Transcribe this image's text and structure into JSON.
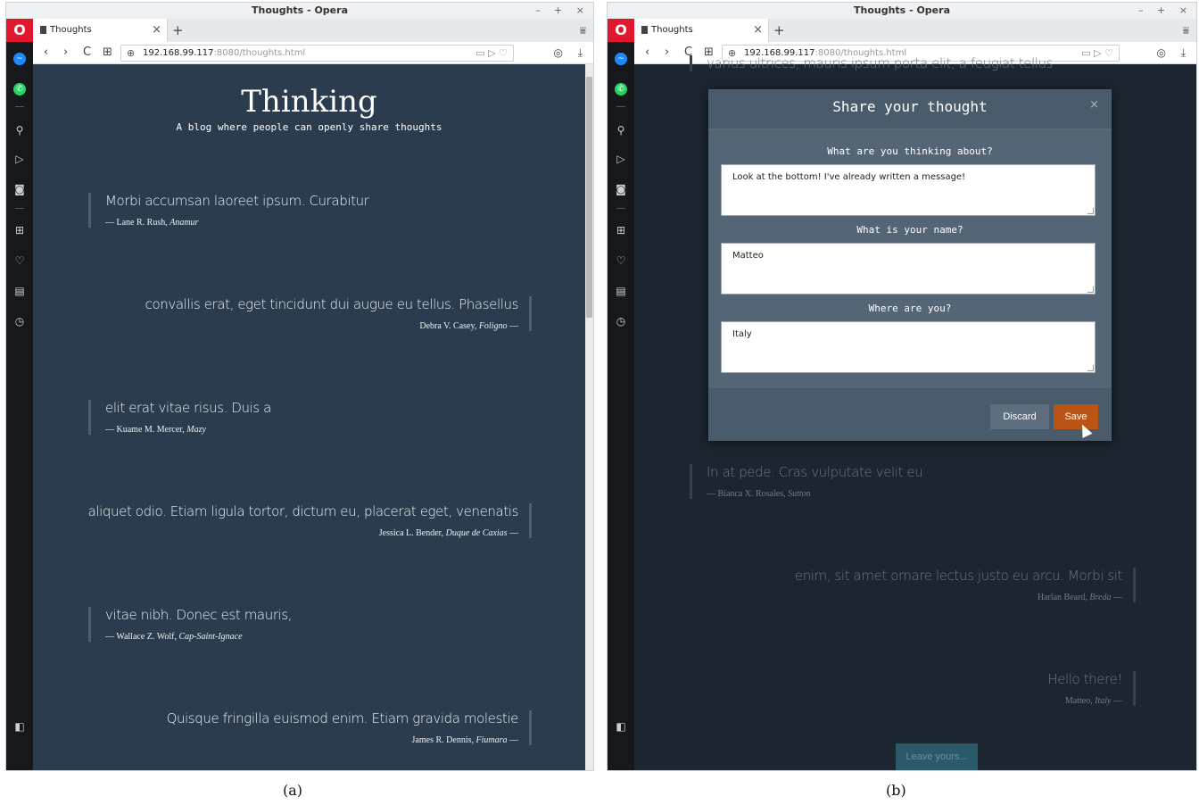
{
  "browser": {
    "window_title": "Thoughts - Opera",
    "logo": "O",
    "tab_title": "Thoughts",
    "tab_close": "×",
    "new_tab": "+",
    "tab_menu": "⩸",
    "url_host": "192.168.99.117",
    "url_path": ":8080/thoughts.html",
    "window_controls": "– + ×",
    "nav": {
      "back": "‹",
      "forward": "›",
      "reload": "C",
      "grid": "⊞",
      "globe": "⊕",
      "url_icons": "▭ ▷ ♡",
      "snap": "◎",
      "download": "⤓"
    },
    "sidebar_icons": [
      {
        "name": "messenger-icon",
        "glyph": "~",
        "color": "#1e88ff"
      },
      {
        "name": "whatsapp-icon",
        "glyph": "✆",
        "color": "#25d366"
      },
      {
        "name": "search-icon",
        "glyph": "⚲"
      },
      {
        "name": "send-icon",
        "glyph": "▷"
      },
      {
        "name": "camera-icon",
        "glyph": "◙"
      },
      {
        "name": "speed-dial-icon",
        "glyph": "⊞"
      },
      {
        "name": "heart-icon",
        "glyph": "♡"
      },
      {
        "name": "news-icon",
        "glyph": "▤"
      },
      {
        "name": "history-icon",
        "glyph": "◷"
      }
    ],
    "sidebar_toggle": "◧"
  },
  "blog": {
    "title": "Thinking",
    "subtitle": "A blog where people can openly share thoughts"
  },
  "panel_a": {
    "posts": [
      {
        "text": "Morbi accumsan laoreet ipsum. Curabitur",
        "author": "— Lane R. Rush, ",
        "place": "Anamur",
        "suffix": "",
        "align": "left"
      },
      {
        "text": "convallis erat, eget tincidunt dui augue eu tellus. Phasellus",
        "author": "Debra V. Casey, ",
        "place": "Foligno",
        "suffix": " —",
        "align": "right"
      },
      {
        "text": "elit erat vitae risus. Duis a",
        "author": "— Kuame M. Mercer, ",
        "place": "Mazy",
        "suffix": "",
        "align": "left"
      },
      {
        "text": "aliquet odio. Etiam ligula tortor, dictum eu, placerat eget, venenatis",
        "author": "Jessica L. Bender, ",
        "place": "Duque de Caxias",
        "suffix": " —",
        "align": "right"
      },
      {
        "text": "vitae nibh. Donec est mauris,",
        "author": "— Wallace Z. Wolf, ",
        "place": "Cap-Saint-Ignace",
        "suffix": "",
        "align": "left"
      },
      {
        "text": "Quisque fringilla euismod enim. Etiam gravida molestie",
        "author": "James R. Dennis, ",
        "place": "Fiumara",
        "suffix": " —",
        "align": "right"
      }
    ]
  },
  "panel_b": {
    "top_fragment": "varius ultrices, mauris ipsum porta elit, a feugiat tellus",
    "posts": [
      {
        "text": "In at pede. Cras vulputate velit eu",
        "author": "— Bianca X. Rosales, ",
        "place": "Sutton",
        "suffix": "",
        "align": "left"
      },
      {
        "text": "enim, sit amet ornare lectus justo eu arcu. Morbi sit",
        "author": "Harlan Beard, ",
        "place": "Breda",
        "suffix": " —",
        "align": "right"
      },
      {
        "text": "Hello there!",
        "author": "Matteo, ",
        "place": "Italy",
        "suffix": " —",
        "align": "right"
      }
    ],
    "leave_button": "Leave yours...",
    "modal": {
      "title": "Share your thought",
      "close": "×",
      "thought_label": "What are you thinking about?",
      "thought_value": "Look at the bottom! I've already written a message!",
      "name_label": "What is your name?",
      "name_value": "Matteo",
      "place_label": "Where are you?",
      "place_value": "Italy",
      "discard": "Discard",
      "save": "Save"
    }
  },
  "captions": {
    "a": "(a)",
    "b": "(b)"
  },
  "colors": {
    "page_bg": "#2b3c4e",
    "save": "#b95415",
    "opera_red": "#e0172d"
  }
}
